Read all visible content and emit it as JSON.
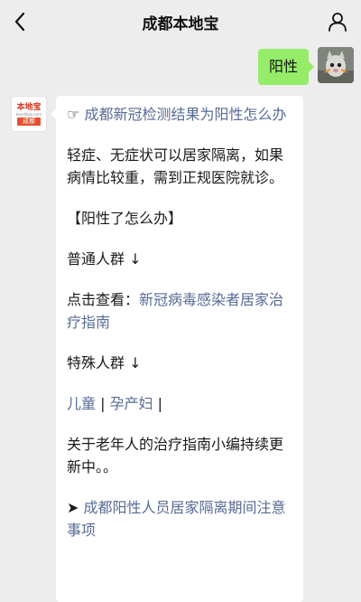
{
  "header": {
    "title": "成都本地宝",
    "back_icon": "chevron-left-icon",
    "profile_icon": "person-icon"
  },
  "outgoing": {
    "text": "阳性"
  },
  "bot": {
    "logo_text": "本地宝",
    "logo_url": "bendibao.com",
    "logo_city": "成都"
  },
  "message": {
    "headline_icon": "☞",
    "headline": "成都新冠检测结果为阳性怎么办",
    "intro": "轻症、无症状可以居家隔离，如果病情比较重，需到正规医院就诊。",
    "section_title": "【阳性了怎么办】",
    "general_label": "普通人群 ↓",
    "view_prefix": "点击查看：",
    "view_link": "新冠病毒感染者居家治疗指南",
    "special_label": "特殊人群 ↓",
    "children_link": "儿童",
    "separator1": " | ",
    "pregnant_link": "孕产妇",
    "separator2": " |",
    "elderly_note": "关于老年人的治疗指南小编持续更新中。。",
    "arrow_icon": "➤",
    "final_link": "成都阳性人员居家隔离期间注意事项"
  },
  "colors": {
    "background": "#ededed",
    "outgoing_bubble": "#95ec69",
    "link": "#576b95",
    "brand_red": "#e4502c"
  }
}
